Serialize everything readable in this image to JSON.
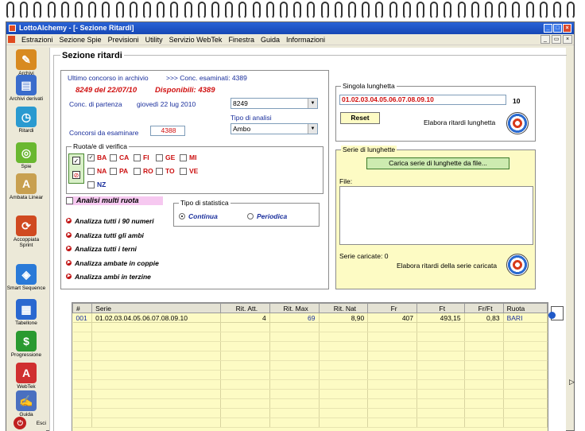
{
  "window": {
    "title": "LottoAlchemy - [- Sezione Ritardi]"
  },
  "menu": [
    "Estrazioni",
    "Sezione Spie",
    "Previsioni",
    "Utility",
    "Servizio WebTek",
    "Finestra",
    "Guida",
    "Informazioni"
  ],
  "sidebar": [
    {
      "label": "Archivi",
      "icon": "pencil-icon",
      "color": "#d88a20"
    },
    {
      "label": "Archivi derivati",
      "icon": "book-icon",
      "color": "#3a6ccc"
    },
    {
      "label": "Ritardi",
      "icon": "clock-icon",
      "color": "#2a9ad0"
    },
    {
      "label": "Spie",
      "icon": "binoculars-icon",
      "color": "#6ab830"
    },
    {
      "label": "Ambata Linear",
      "icon": "letter-a-icon",
      "color": "#c8a050"
    },
    {
      "label": "Accoppiata Sprint",
      "icon": "recycle-icon",
      "color": "#d04a20"
    },
    {
      "label": "Smart Sequence",
      "icon": "shield-icon",
      "color": "#2a7ad8"
    },
    {
      "label": "Tabellone",
      "icon": "table-icon",
      "color": "#2a68d0"
    },
    {
      "label": "Progressione",
      "icon": "dollar-icon",
      "color": "#2a9a30"
    },
    {
      "label": "WebTek",
      "icon": "webtek-icon",
      "color": "#d03030"
    },
    {
      "label": "Guida",
      "icon": "guide-icon",
      "color": "#4a70c0"
    },
    {
      "label": "Esci",
      "icon": "exit-icon",
      "color": "#c02020"
    }
  ],
  "main": {
    "title": "Sezione ritardi",
    "archive": {
      "label_last": "Ultimo concorso in archivio",
      "label_examined": ">>> Conc. esaminati: 4389",
      "last_value": "8249 del 22/07/10",
      "available": "Disponibili: 4389",
      "start_label": "Conc. di partenza",
      "start_date": "giovedì 22 lug 2010",
      "start_combo": "8249",
      "analysis_label": "Tipo di analisi",
      "analysis_combo": "Ambo",
      "to_examine_label": "Concorsi da esaminare",
      "to_examine_value": "4388"
    },
    "wheels": {
      "label": "Ruota/e di verifica",
      "items": [
        {
          "name": "BA",
          "checked": true
        },
        {
          "name": "CA",
          "checked": false
        },
        {
          "name": "FI",
          "checked": false
        },
        {
          "name": "GE",
          "checked": false
        },
        {
          "name": "MI",
          "checked": false
        },
        {
          "name": "NA",
          "checked": false
        },
        {
          "name": "PA",
          "checked": false
        },
        {
          "name": "RO",
          "checked": false
        },
        {
          "name": "TO",
          "checked": false
        },
        {
          "name": "VE",
          "checked": false
        },
        {
          "name": "NZ",
          "checked": false
        }
      ],
      "multi": "Analisi multi ruota"
    },
    "stat": {
      "label": "Tipo di statistica",
      "continua": "Continua",
      "periodica": "Periodica"
    },
    "links": [
      "Analizza tutti i 90 numeri",
      "Analizza tutti gli ambi",
      "Analizza tutti i terni",
      "Analizza ambate in coppie",
      "Analizza ambi in terzine"
    ],
    "single": {
      "label": "Singola lunghetta",
      "value": "01.02.03.04.05.06.07.08.09.10",
      "count": "10",
      "reset": "Reset",
      "elabora": "Elabora ritardi lunghetta"
    },
    "series": {
      "label": "Serie di lunghette",
      "load_button": "Carica serie di lunghette da file...",
      "file_label": "File:",
      "loaded": "Serie caricate: 0",
      "elabora": "Elabora ritardi della serie caricata"
    },
    "table": {
      "headers": [
        "#",
        "Serie",
        "Rit. Att.",
        "Rit. Max",
        "Rit. Nat",
        "Fr",
        "Ft",
        "Fr/Ft",
        "Ruota"
      ],
      "rows": [
        [
          "001",
          "01.02.03.04.05.06.07.08.09.10",
          "4",
          "69",
          "8,90",
          "407",
          "493,15",
          "0,83",
          "BARI"
        ]
      ]
    }
  }
}
